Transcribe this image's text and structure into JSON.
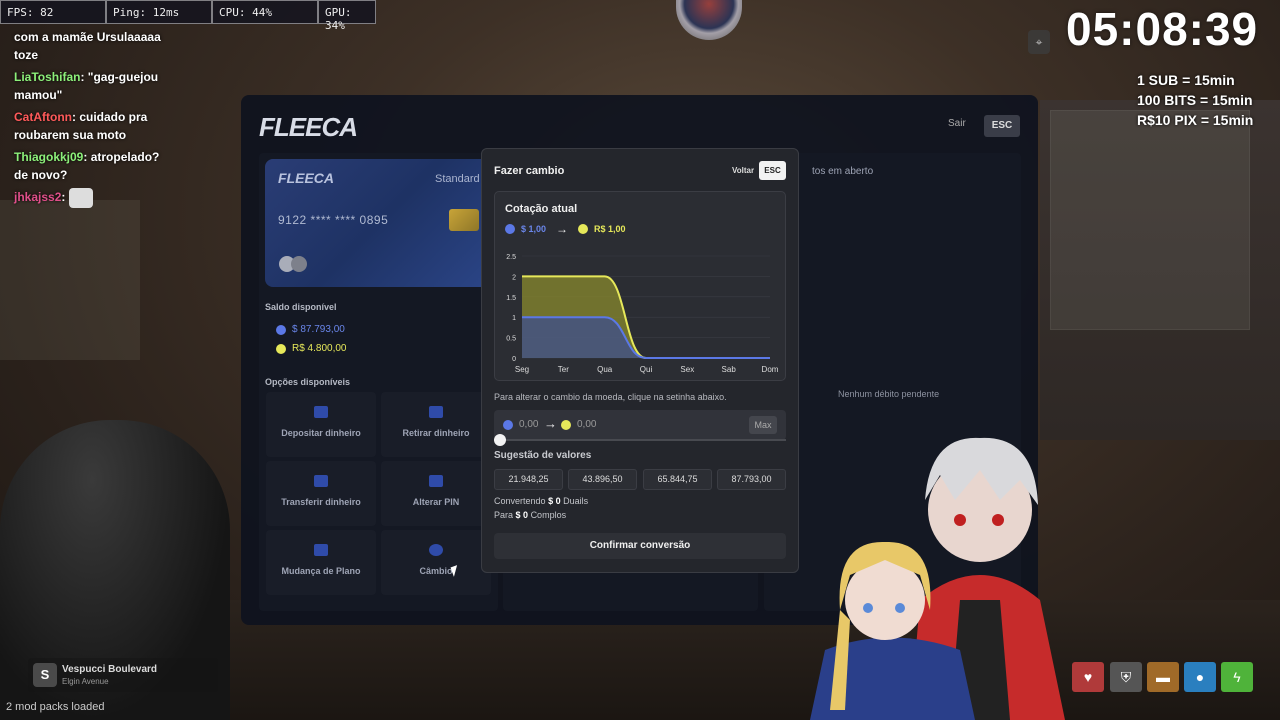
{
  "stats": {
    "fps": "FPS: 82",
    "ping": "Ping: 12ms",
    "cpu": "CPU: 44%",
    "gpu": "GPU: 34%"
  },
  "chat": [
    {
      "name": "",
      "text": "com a mamãe Ursulaaaaa toze"
    },
    {
      "name": "LiaToshifan",
      "text": ": \"gag-guejou mamou\""
    },
    {
      "name": "CatAftonn",
      "text": ": cuidado pra roubarem sua moto"
    },
    {
      "name": "Thiagokkj09",
      "text": ": atropelado? de novo?"
    },
    {
      "name": "jhkajss2",
      "text": ":"
    }
  ],
  "clock": "05:08:39",
  "info": [
    "1 SUB = 15min",
    "100 BITS = 15min",
    "R$10 PIX = 15min"
  ],
  "bank": {
    "logo": "FLEECA",
    "sair": "Sair",
    "esc": "ESC",
    "card": {
      "logo": "FLEECA",
      "type": "Standard",
      "number": "9122 **** **** 0895"
    },
    "saldo_title": "Saldo disponível",
    "balance_usd": "$ 87.793,00",
    "balance_brl": "R$ 4.800,00",
    "options_title": "Opções disponíveis",
    "options": [
      "Depositar dinheiro",
      "Retirar dinheiro",
      "Transferir dinheiro",
      "Alterar PIN",
      "Mudança de Plano",
      "Câmbio"
    ],
    "aberto_fragment": "tos em aberto",
    "no_debt": "Nenhum débito pendente"
  },
  "modal": {
    "title": "Fazer cambio",
    "voltar": "Voltar",
    "esc": "ESC",
    "cotacao_title": "Cotação atual",
    "rate_usd": "$ 1,00",
    "rate_brl": "R$ 1,00",
    "hint": "Para alterar o cambio da moeda, clique na setinha abaixo.",
    "from_value": "0,00",
    "to_value": "0,00",
    "max": "Max",
    "suggestions_title": "Sugestão de valores",
    "suggestions": [
      "21.948,25",
      "43.896,50",
      "65.844,75",
      "87.793,00"
    ],
    "conv_line1_pre": "Convertendo",
    "conv_line1_amount": "$ 0",
    "conv_line1_post": "Duails",
    "conv_line2_pre": "Para",
    "conv_line2_amount": "$ 0",
    "conv_line2_post": "Complos",
    "confirm": "Confirmar conversão"
  },
  "colors": {
    "usd": "#5b78e6",
    "brl": "#e6e85a",
    "accent_blue": "#2f4ba9"
  },
  "chart_data": {
    "type": "area",
    "categories": [
      "Seg",
      "Ter",
      "Qua",
      "Qui",
      "Sex",
      "Sab",
      "Dom"
    ],
    "series": [
      {
        "values": [
          2,
          2,
          2,
          0,
          0,
          0,
          0
        ],
        "color": "#e6e85a"
      },
      {
        "values": [
          1,
          1,
          1,
          0,
          0,
          0,
          0
        ],
        "color": "#5b78e6"
      }
    ],
    "y_ticks": [
      "0",
      "0.5",
      "1",
      "1.5",
      "2",
      "2.5"
    ],
    "ylim": [
      0,
      2.5
    ],
    "grid": true
  },
  "street": {
    "badge": "S",
    "name": "Vespucci Boulevard",
    "sub": "Elgin Avenue"
  },
  "mods": "2 mod packs loaded",
  "hud_icons": [
    "heart-icon",
    "shield-icon",
    "food-icon",
    "water-icon",
    "energy-icon"
  ]
}
